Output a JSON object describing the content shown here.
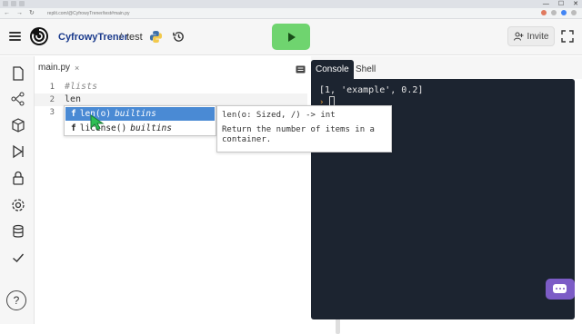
{
  "browser": {
    "url": "replit.com/@CyfrowyTrener/test#main.py",
    "window_controls": [
      "—",
      "☐",
      "✕"
    ]
  },
  "header": {
    "project_name": "CyfrowyTrener",
    "separator": "/",
    "file_name": "test",
    "run_icon": "play-icon",
    "invite_label": "Invite"
  },
  "sidebar": {
    "icons": [
      "file-icon",
      "share-graph-icon",
      "package-icon",
      "debugger-icon",
      "lock-icon",
      "settings-icon",
      "database-icon",
      "check-icon"
    ],
    "help_label": "?"
  },
  "editor": {
    "tab_label": "main.py",
    "tab_close": "×",
    "lines": [
      {
        "num": "1",
        "text": "#lists"
      },
      {
        "num": "2",
        "text": "len"
      },
      {
        "num": "3",
        "text": ""
      }
    ],
    "autocomplete": [
      {
        "kind": "f",
        "name": "len(o)",
        "module": "builtins",
        "selected": true
      },
      {
        "kind": "f",
        "name": "license()",
        "module": "builtins",
        "selected": false
      }
    ],
    "doc_signature": "len(o: Sized, /) -> int",
    "doc_description": "Return the number of items in a container."
  },
  "console": {
    "tabs": [
      "Console",
      "Shell"
    ],
    "output": "[1, 'example', 0.2]",
    "prompt": "›"
  },
  "colors": {
    "run_button": "#6fd46f",
    "console_bg": "#1c2430",
    "suggest_selected": "#4a8ad4",
    "chat_button": "#7c5cc6"
  }
}
